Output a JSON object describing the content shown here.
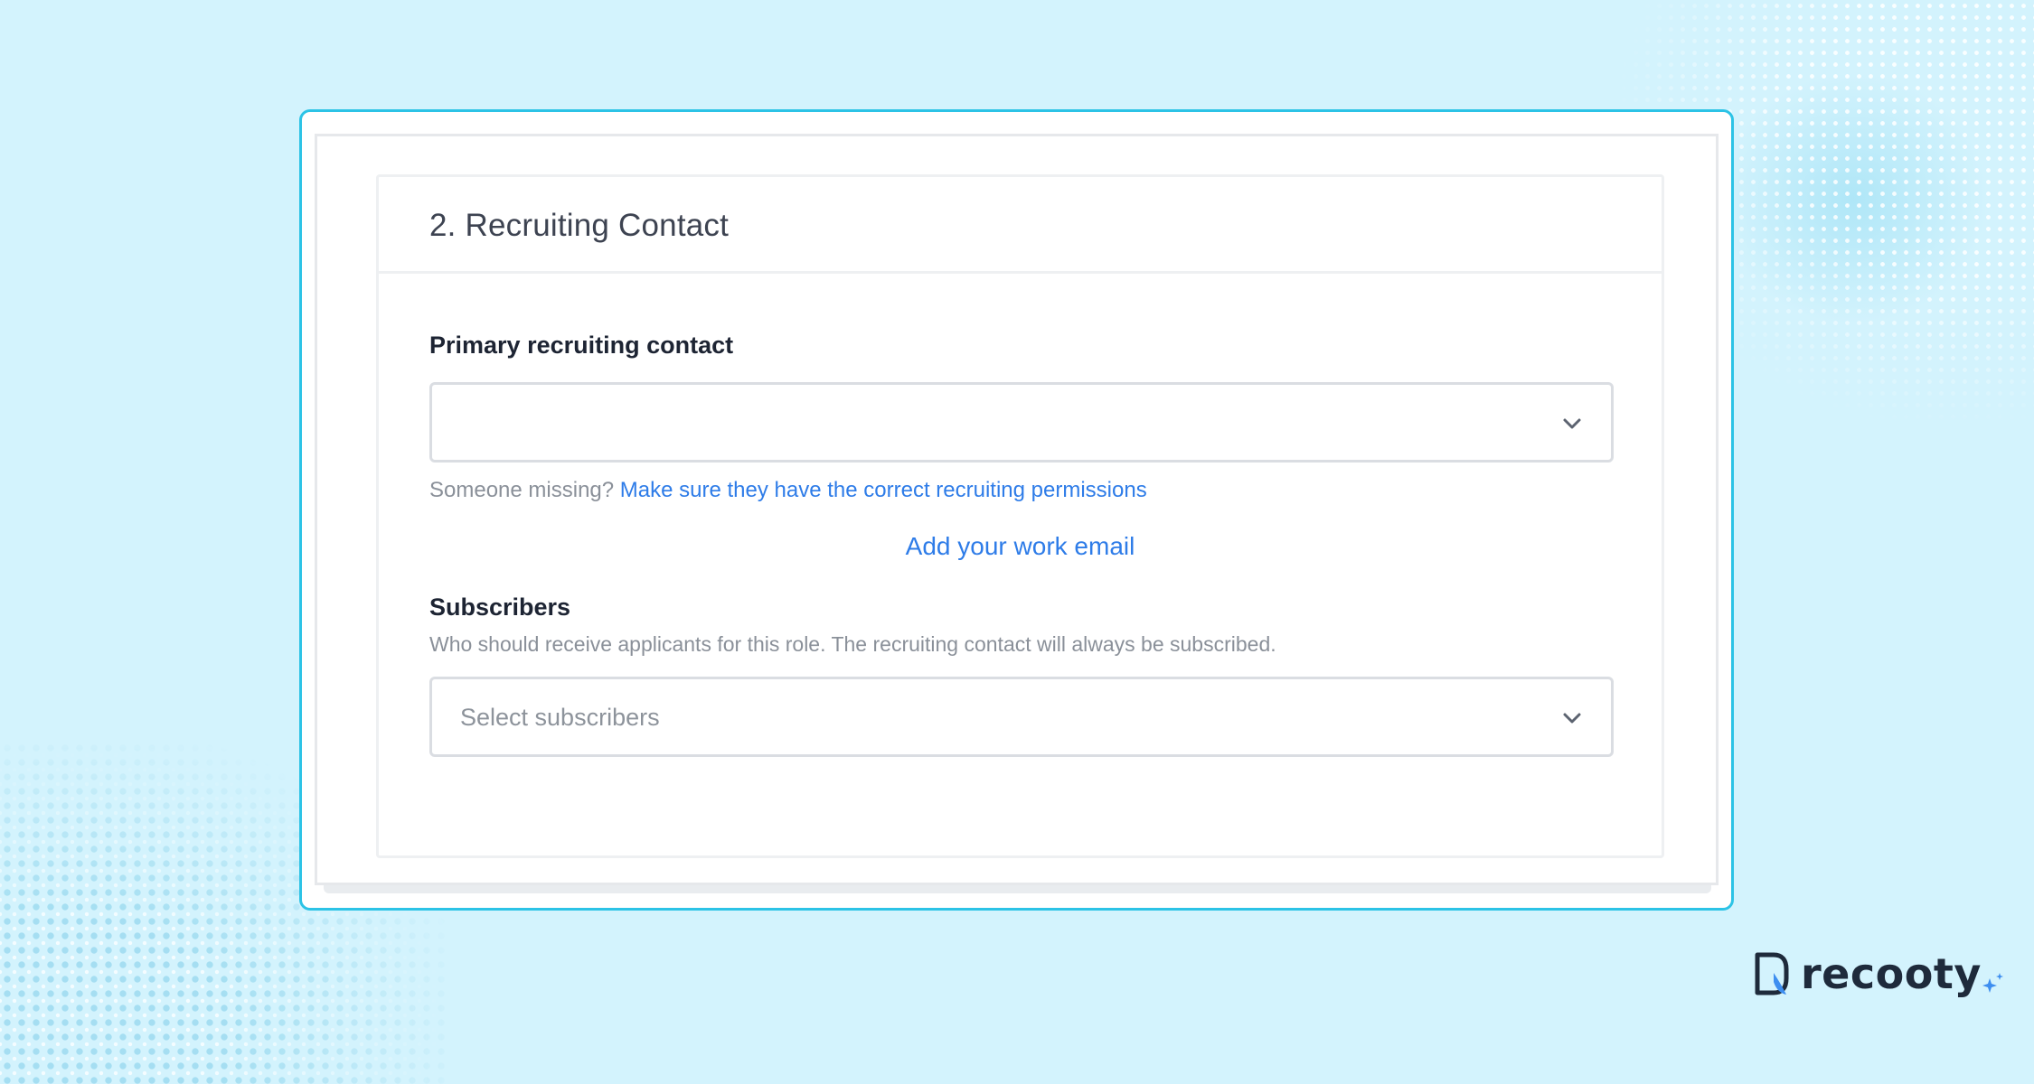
{
  "card": {
    "title": "2. Recruiting Contact"
  },
  "primary_contact": {
    "label": "Primary recruiting contact",
    "value": "",
    "helper_prefix": "Someone missing?",
    "helper_link": "Make sure they have the correct recruiting permissions"
  },
  "add_email_link": "Add your work email",
  "subscribers": {
    "label": "Subscribers",
    "description": "Who should receive applicants for this role. The recruiting contact will always be subscribed.",
    "placeholder": "Select subscribers"
  },
  "brand": {
    "name": "recooty",
    "accent_color": "#2cc3e6",
    "link_color": "#2e7ce8"
  },
  "icons": {
    "dropdown": "chevron-down-icon",
    "logo": "recooty-logo-icon",
    "sparkle": "sparkle-icon"
  }
}
